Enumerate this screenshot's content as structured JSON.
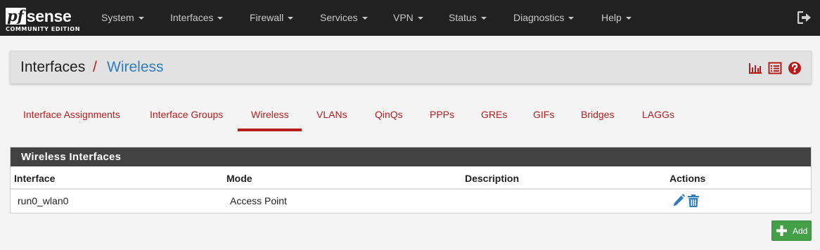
{
  "brand": {
    "logo_pf": "pf",
    "logo_sense": "sense",
    "edition": "COMMUNITY EDITION"
  },
  "nav": {
    "items": [
      {
        "label": "System"
      },
      {
        "label": "Interfaces"
      },
      {
        "label": "Firewall"
      },
      {
        "label": "Services"
      },
      {
        "label": "VPN"
      },
      {
        "label": "Status"
      },
      {
        "label": "Diagnostics"
      },
      {
        "label": "Help"
      }
    ],
    "logout_icon": "sign-out-icon"
  },
  "breadcrumb": {
    "parent": "Interfaces",
    "separator": "/",
    "current": "Wireless"
  },
  "header_icons": [
    "bar-chart-icon",
    "list-icon",
    "help-question-icon"
  ],
  "tabs": [
    {
      "label": "Interface Assignments",
      "active": false
    },
    {
      "label": "Interface Groups",
      "active": false
    },
    {
      "label": "Wireless",
      "active": true
    },
    {
      "label": "VLANs",
      "active": false
    },
    {
      "label": "QinQs",
      "active": false
    },
    {
      "label": "PPPs",
      "active": false
    },
    {
      "label": "GREs",
      "active": false
    },
    {
      "label": "GIFs",
      "active": false
    },
    {
      "label": "Bridges",
      "active": false
    },
    {
      "label": "LAGGs",
      "active": false
    }
  ],
  "panel": {
    "title": "Wireless Interfaces",
    "columns": [
      "Interface",
      "Mode",
      "Description",
      "Actions"
    ],
    "rows": [
      {
        "interface": "run0_wlan0",
        "mode": "Access Point",
        "description": "",
        "actions": [
          "pencil-edit-icon",
          "trash-delete-icon"
        ]
      }
    ]
  },
  "add_button": {
    "label": "Add",
    "icon": "plus-icon"
  },
  "colors": {
    "navbar": "#212121",
    "accent_red": "#b71c1c",
    "link_blue": "#2f7dbf",
    "panel_heading": "#424242",
    "add_green": "#43a047"
  }
}
